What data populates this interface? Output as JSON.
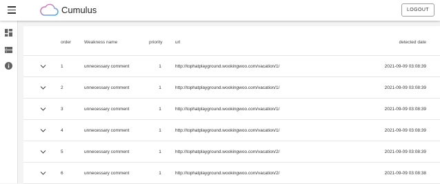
{
  "app": {
    "title": "Cumulus",
    "logout_label": "LOGOUT"
  },
  "sidebar": {
    "items": [
      {
        "icon": "dashboard-icon"
      },
      {
        "icon": "storage-icon"
      },
      {
        "icon": "info-icon"
      }
    ]
  },
  "table": {
    "columns": {
      "order": "order",
      "name": "Weakness name",
      "priority": "priority",
      "url": "url",
      "date": "detected date"
    },
    "rows": [
      {
        "order": "1",
        "name": "unnecessary comment",
        "priority": "1",
        "url": "http://tophatplayground.wookingwoo.com/vacation/1/",
        "date": "2021-09-09 03:08:39"
      },
      {
        "order": "2",
        "name": "unnecessary comment",
        "priority": "1",
        "url": "http://tophatplayground.wookingwoo.com/vacation/1/",
        "date": "2021-09-09 03:08:39"
      },
      {
        "order": "3",
        "name": "unnecessary comment",
        "priority": "1",
        "url": "http://tophatplayground.wookingwoo.com/vacation/1/",
        "date": "2021-09-09 03:08:39"
      },
      {
        "order": "4",
        "name": "unnecessary comment",
        "priority": "1",
        "url": "http://tophatplayground.wookingwoo.com/vacation/1/",
        "date": "2021-09-09 03:08:39"
      },
      {
        "order": "5",
        "name": "unnecessary comment",
        "priority": "1",
        "url": "http://tophatplayground.wookingwoo.com/vacation/2/",
        "date": "2021-09-09 03:08:39"
      },
      {
        "order": "6",
        "name": "unnecessary comment",
        "priority": "1",
        "url": "http://tophatplayground.wookingwoo.com/vacation/2/",
        "date": "2021-09-09 03:08:38"
      }
    ]
  }
}
